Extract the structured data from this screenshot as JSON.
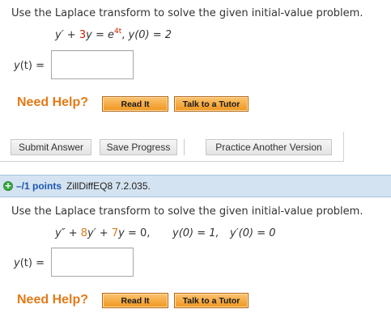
{
  "question1": {
    "instruction": "Use the Laplace transform to solve the given initial-value problem.",
    "equation": {
      "lhs1": "y′",
      "plus": " + ",
      "coef": "3",
      "lhs2": "y",
      "eq": " = ",
      "rhs_base": "e",
      "rhs_exp": "4t",
      "sep": ",  ",
      "ic": "y(0) = 2"
    },
    "answer_label_var": "y",
    "answer_label_rest": "(t) =",
    "answer_value": "",
    "need_help": "Need Help?",
    "read_it": "Read It",
    "talk_tutor": "Talk to a Tutor"
  },
  "actions": {
    "submit": "Submit Answer",
    "save": "Save Progress",
    "practice": "Practice Another Version"
  },
  "question2": {
    "points": "–/1 points",
    "id": "ZillDiffEQ8 7.2.035.",
    "instruction": "Use the Laplace transform to solve the given initial-value problem.",
    "equation": {
      "t1": "y″",
      "p1": " + ",
      "c1": "8",
      "t2": "y′",
      "p2": " + ",
      "c2": "7",
      "t3": "y",
      "eq": " = 0,",
      "ic1": "y(0) = 1,",
      "ic2": "y′(0) = 0"
    },
    "answer_label_var": "y",
    "answer_label_rest": "(t) =",
    "answer_value": "",
    "need_help": "Need Help?",
    "read_it": "Read It",
    "talk_tutor": "Talk to a Tutor"
  },
  "colors": {
    "help_orange": "#e37a17",
    "points_blue": "#1f56b0",
    "section_bar": "#d4e3f1",
    "coefficient_red": "#cc2200"
  },
  "icons": {
    "section_icon": "plus-circle-icon"
  }
}
